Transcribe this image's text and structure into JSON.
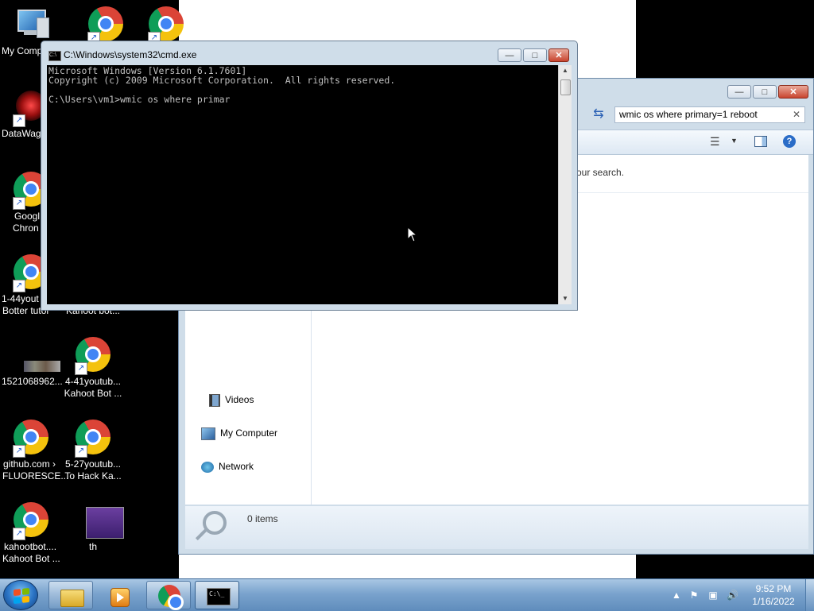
{
  "desktop": {
    "icons": [
      {
        "label1": "My Comp",
        "label2": ""
      },
      {
        "label1": "DataWag",
        "label2": ""
      },
      {
        "label1": "Googl",
        "label2": "Chron"
      },
      {
        "label1": "1-44yout",
        "label2": "Botter tutor"
      },
      {
        "label1": "",
        "label2": "Kahoot bot..."
      },
      {
        "label1": "1521068962...",
        "label2": ""
      },
      {
        "label1": "4-41youtub...",
        "label2": "Kahoot Bot ..."
      },
      {
        "label1": "github.com ›",
        "label2": "FLUORESCE..."
      },
      {
        "label1": "5-27youtub...",
        "label2": "To Hack Ka..."
      },
      {
        "label1": "kahootbot....",
        "label2": "Kahoot Bot ..."
      },
      {
        "label1": "th",
        "label2": ""
      }
    ]
  },
  "cmd": {
    "title": "C:\\Windows\\system32\\cmd.exe",
    "lines": "Microsoft Windows [Version 6.1.7601]\nCopyright (c) 2009 Microsoft Corporation.  All rights reserved.\n\nC:\\Users\\vm1>wmic os where primar",
    "minimize": "—",
    "maximize": "□",
    "close": "✕"
  },
  "explorer": {
    "search_value": "wmic os where primary=1 reboot",
    "search_clear": "✕",
    "message": "our search.",
    "nav": {
      "videos": "Videos",
      "my_computer": "My Computer",
      "network": "Network"
    },
    "status": "0 items",
    "minimize": "—",
    "maximize": "□",
    "close": "✕"
  },
  "taskbar": {
    "time": "9:52 PM",
    "date": "1/16/2022",
    "cmd_label": "C:\\_"
  }
}
